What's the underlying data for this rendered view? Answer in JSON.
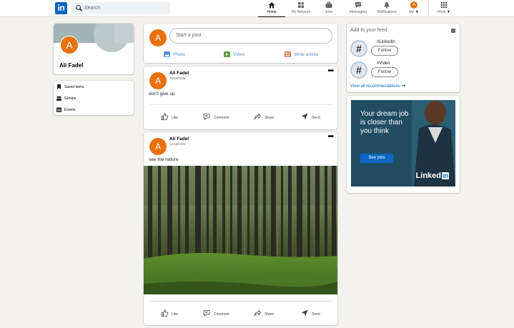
{
  "colors": {
    "brand": "#0a66c2",
    "avatar": "#e8710a",
    "background": "#f3f2ef"
  },
  "header": {
    "logo": "in",
    "search": {
      "placeholder": "Search",
      "value": ""
    },
    "nav": [
      {
        "label": "Home",
        "icon": "home-icon",
        "active": true
      },
      {
        "label": "My Network",
        "icon": "network-icon",
        "active": false
      },
      {
        "label": "Jobs",
        "icon": "briefcase-icon",
        "active": false
      },
      {
        "label": "Messaging",
        "icon": "chat-icon",
        "active": false
      },
      {
        "label": "Notifications",
        "icon": "bell-icon",
        "active": false
      },
      {
        "label": "Me",
        "icon": "avatar",
        "avatar_letter": "A",
        "active": false
      },
      {
        "label": "Work",
        "icon": "grid-icon",
        "active": false
      }
    ]
  },
  "sidebar": {
    "profile": {
      "initial": "A",
      "name": "Ali Fadel"
    },
    "items": [
      {
        "label": "Saved items",
        "icon": "bookmark-icon"
      },
      {
        "label": "Groups",
        "icon": "groups-icon"
      },
      {
        "label": "Events",
        "icon": "calendar-icon"
      }
    ]
  },
  "composer": {
    "initial": "A",
    "placeholder": "Start a post",
    "actions": [
      {
        "label": "Photo",
        "icon": "photo-icon",
        "color": "#5a8fcf"
      },
      {
        "label": "Video",
        "icon": "video-icon",
        "color": "#5f9b41"
      },
      {
        "label": "Write article",
        "icon": "article-icon",
        "color": "#e16745"
      }
    ]
  },
  "posts": [
    {
      "initial": "A",
      "author": "Ali Fadel",
      "date": "12/15/2024",
      "text": "don't give up",
      "has_image": false
    },
    {
      "initial": "A",
      "author": "Ali Fadel",
      "date": "12/15/2024",
      "text": "see the nature",
      "has_image": true,
      "image": "forest"
    }
  ],
  "post_actions": [
    {
      "label": "Like",
      "icon": "like-icon"
    },
    {
      "label": "Comment",
      "icon": "comment-icon"
    },
    {
      "label": "Share",
      "icon": "share-icon"
    },
    {
      "label": "Send",
      "icon": "send-icon"
    }
  ],
  "feed": {
    "title": "Add to your feed",
    "tags": [
      {
        "name": "#Linkedin",
        "follow": "Follow"
      },
      {
        "name": "#Video",
        "follow": "Follow"
      }
    ],
    "view_all": "View all recommendations"
  },
  "ad": {
    "headline": "Your dream job is closer than you think",
    "button": "See jobs",
    "logo_text": "Linked",
    "logo_in": "in"
  }
}
